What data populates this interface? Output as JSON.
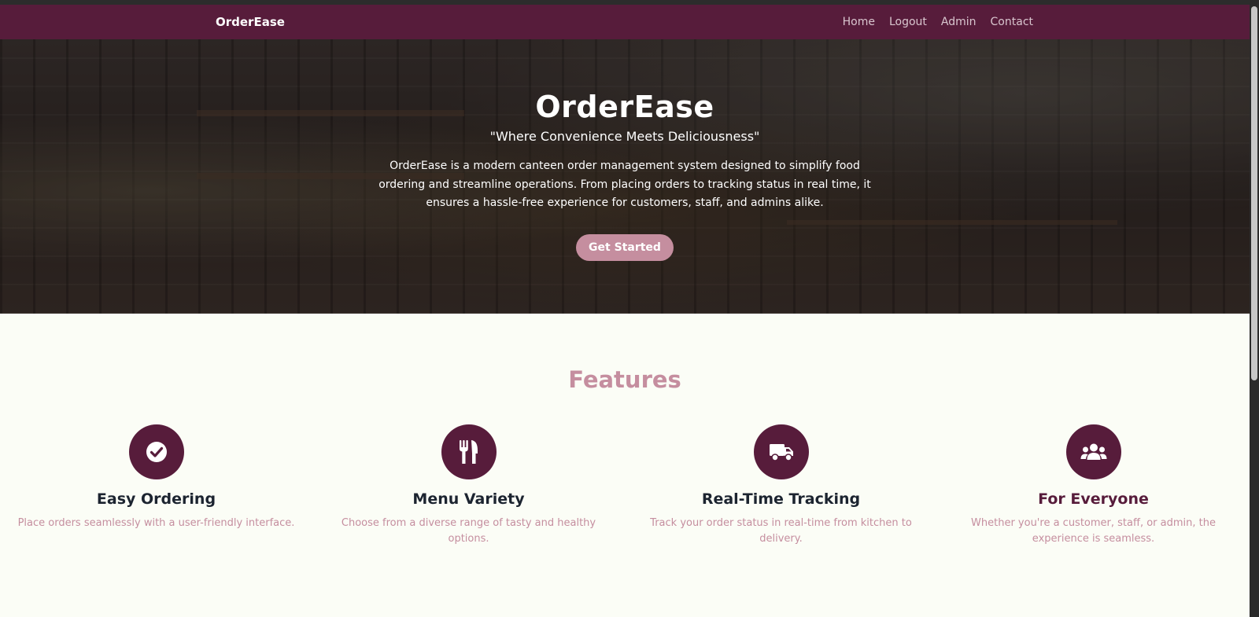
{
  "navbar": {
    "brand": "OrderEase",
    "links": [
      "Home",
      "Logout",
      "Admin",
      "Contact"
    ]
  },
  "hero": {
    "title": "OrderEase",
    "tagline": "\"Where Convenience Meets Deliciousness\"",
    "description": "OrderEase is a modern canteen order management system designed to simplify food ordering and streamline operations. From placing orders to tracking status in real time, it ensures a hassle-free experience for customers, staff, and admins alike.",
    "cta_label": "Get Started"
  },
  "features": {
    "heading": "Features",
    "items": [
      {
        "icon": "check-circle-icon",
        "title": "Easy Ordering",
        "desc": "Place orders seamlessly with a user-friendly interface."
      },
      {
        "icon": "utensils-icon",
        "title": "Menu Variety",
        "desc": "Choose from a diverse range of tasty and healthy options."
      },
      {
        "icon": "truck-icon",
        "title": "Real-Time Tracking",
        "desc": "Track your order status in real-time from kitchen to delivery."
      },
      {
        "icon": "users-icon",
        "title": "For Everyone",
        "desc": "Whether you're a customer, staff, or admin, the experience is seamless."
      }
    ]
  },
  "colors": {
    "primary": "#571c3b",
    "accent": "#c58e9f",
    "background": "#fbfdf6",
    "heading_text": "#1c2430"
  }
}
